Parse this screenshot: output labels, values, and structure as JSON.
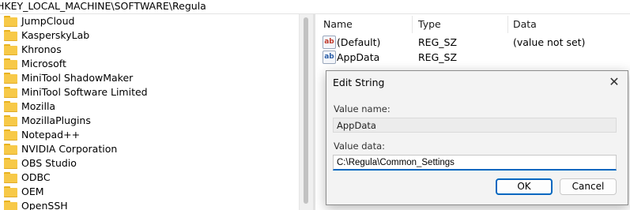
{
  "address": "HKEY_LOCAL_MACHINE\\SOFTWARE\\Regula",
  "tree": {
    "items": [
      "JumpCloud",
      "KasperskyLab",
      "Khronos",
      "Microsoft",
      "MiniTool ShadowMaker",
      "MiniTool Software Limited",
      "Mozilla",
      "MozillaPlugins",
      "Notepad++",
      "NVIDIA Corporation",
      "OBS Studio",
      "ODBC",
      "OEM",
      "OpenSSH"
    ]
  },
  "values": {
    "columns": {
      "name": "Name",
      "type": "Type",
      "data": "Data"
    },
    "rows": [
      {
        "icon": "ab",
        "name": "(Default)",
        "type": "REG_SZ",
        "data": "(value not set)"
      },
      {
        "icon": "ab",
        "name": "AppData",
        "type": "REG_SZ",
        "data": ""
      }
    ]
  },
  "dialog": {
    "title": "Edit String",
    "close_glyph": "✕",
    "value_name_label": "Value name:",
    "value_name": "AppData",
    "value_data_label": "Value data:",
    "value_data": "C:\\Regula\\Common_Settings",
    "ok_label": "OK",
    "cancel_label": "Cancel"
  },
  "colors": {
    "accent": "#0067c0",
    "folder": "#f7c948"
  }
}
